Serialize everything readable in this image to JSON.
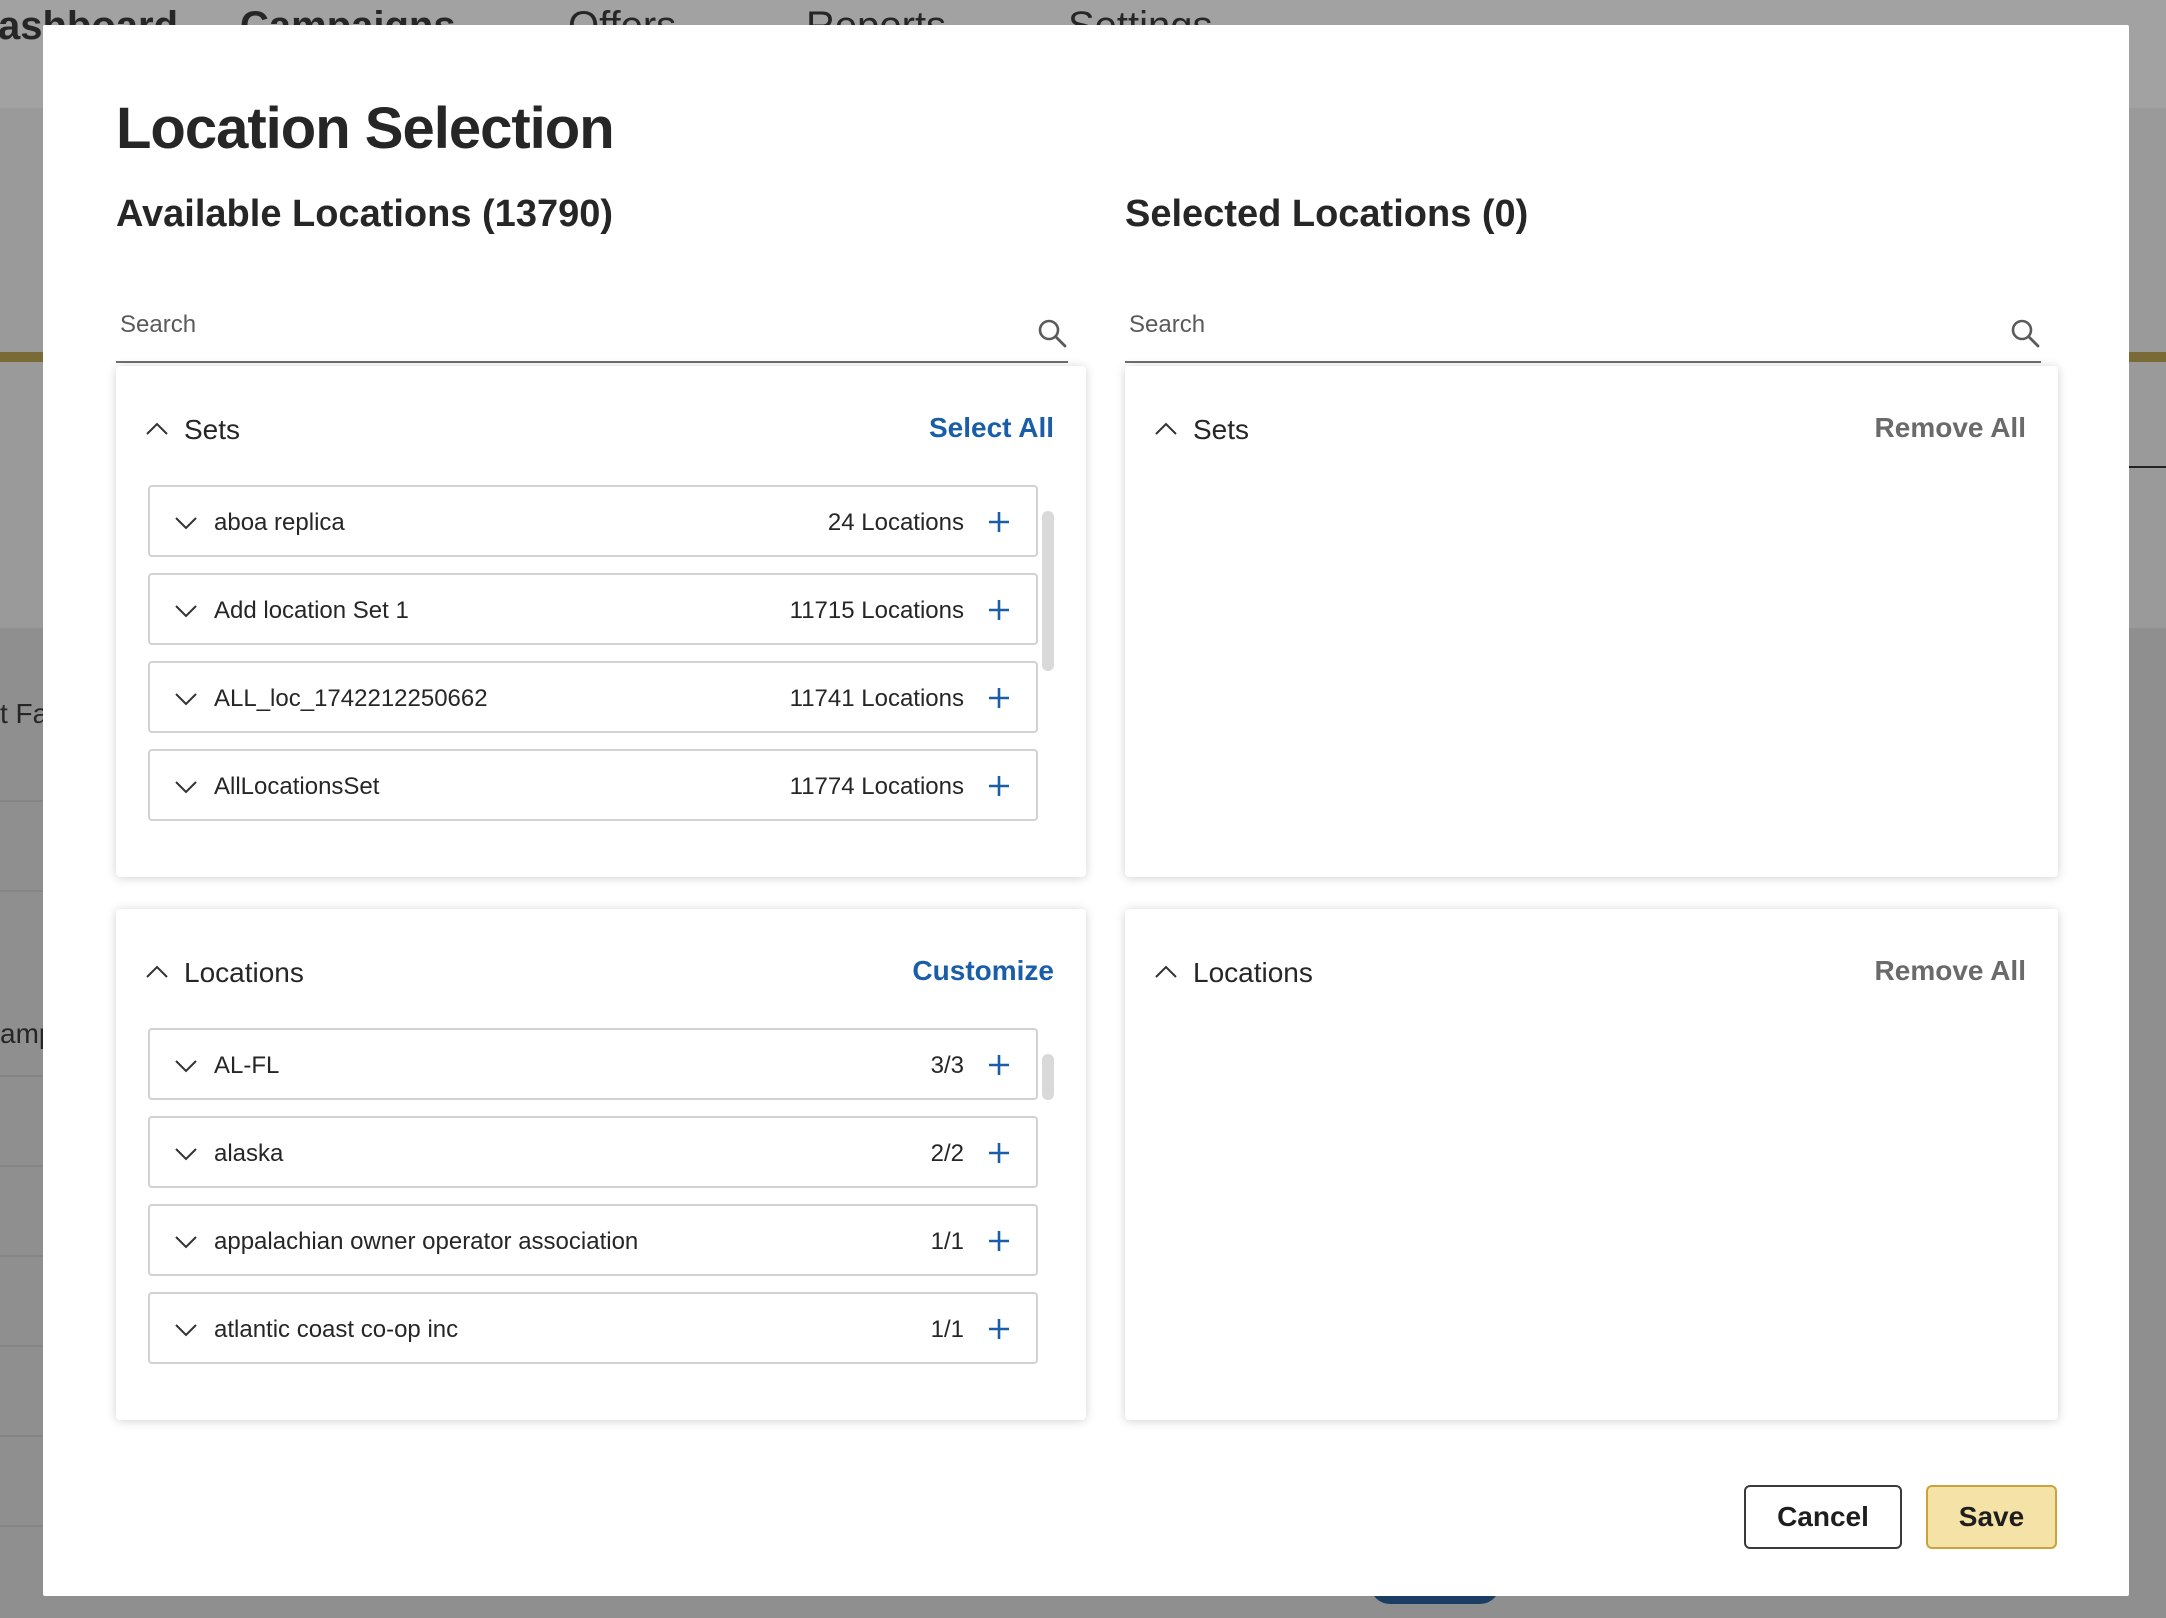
{
  "background": {
    "nav_items": [
      {
        "label": "ashboard"
      },
      {
        "label": "Campaigns"
      },
      {
        "label": "Offers"
      },
      {
        "label": "Reports"
      },
      {
        "label": "Settings"
      }
    ],
    "snippets": [
      "t Fa",
      "amp"
    ]
  },
  "modal": {
    "title": "Location Selection",
    "available": {
      "title": "Available Locations (13790)",
      "search_placeholder": "Search",
      "sets": {
        "label": "Sets",
        "action": "Select All",
        "items": [
          {
            "name": "aboa replica",
            "count": "24 Locations"
          },
          {
            "name": "Add location Set 1",
            "count": "11715 Locations"
          },
          {
            "name": "ALL_loc_1742212250662",
            "count": "11741 Locations"
          },
          {
            "name": "AllLocationsSet",
            "count": "11774 Locations"
          }
        ]
      },
      "locations": {
        "label": "Locations",
        "action": "Customize",
        "items": [
          {
            "name": "AL-FL",
            "count": "3/3"
          },
          {
            "name": "alaska",
            "count": "2/2"
          },
          {
            "name": "appalachian owner operator association",
            "count": "1/1"
          },
          {
            "name": "atlantic coast co-op inc",
            "count": "1/1"
          }
        ]
      }
    },
    "selected": {
      "title": "Selected Locations (0)",
      "search_placeholder": "Search",
      "sets": {
        "label": "Sets",
        "action": "Remove All"
      },
      "locations": {
        "label": "Locations",
        "action": "Remove All"
      }
    },
    "buttons": {
      "cancel": "Cancel",
      "save": "Save"
    }
  },
  "colors": {
    "link_blue": "#1b5ea8",
    "muted_action": "#6a6a6a",
    "save_bg": "#f5e2a6",
    "save_border": "#c9a33e",
    "brand_stripe": "#c9a33e"
  }
}
